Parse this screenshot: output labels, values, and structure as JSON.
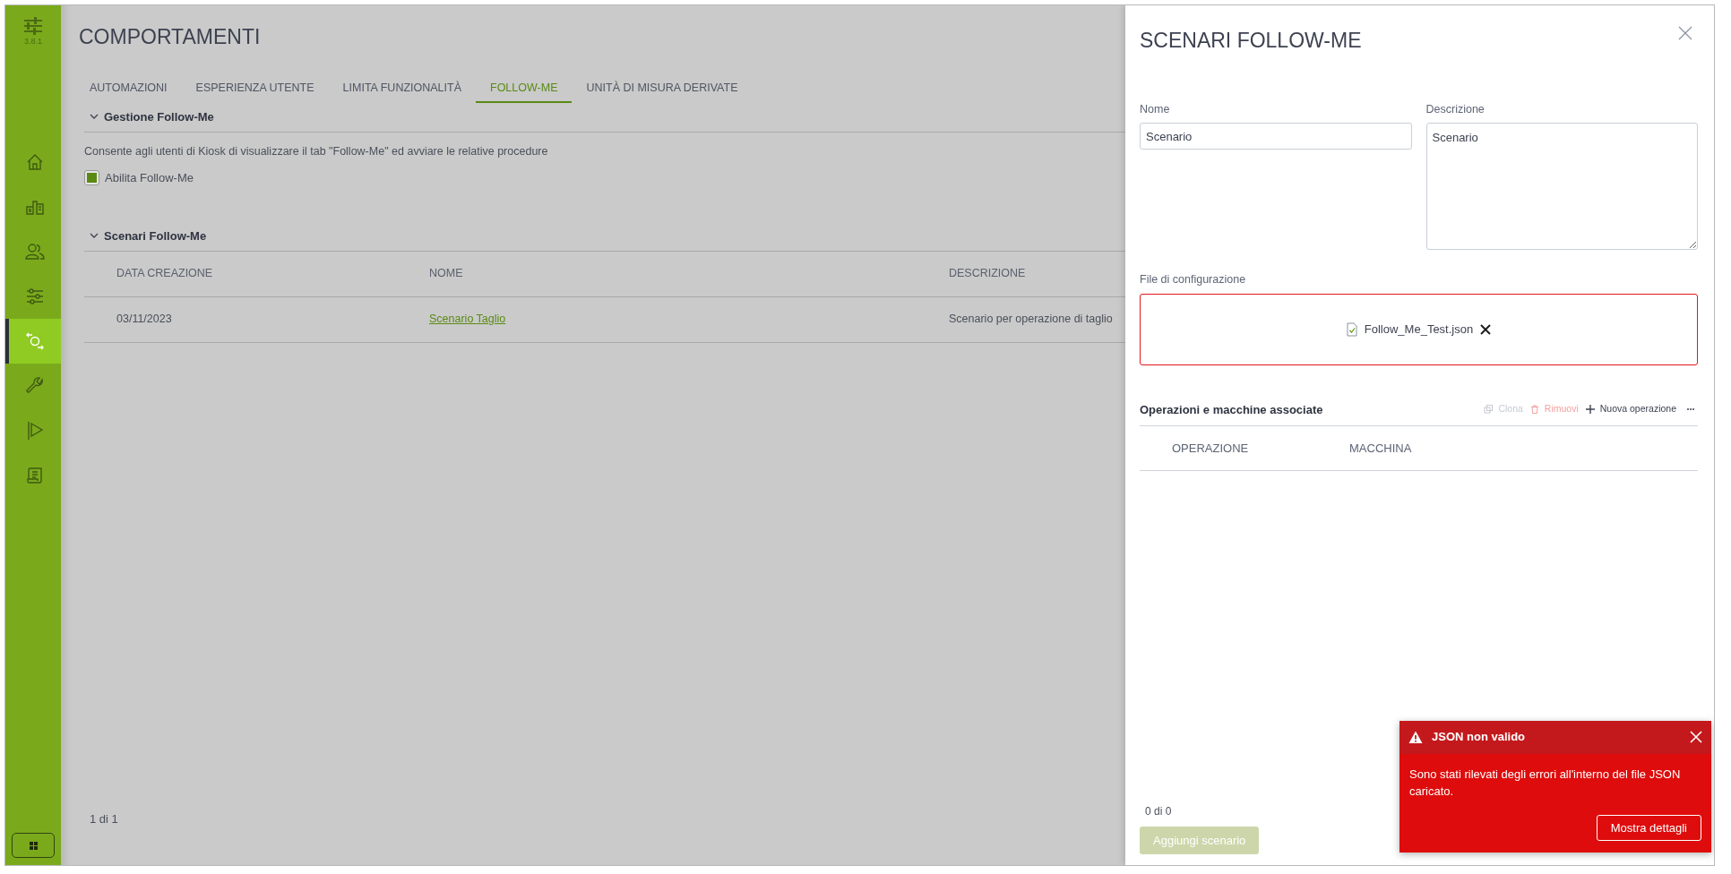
{
  "app": {
    "version": "3.8.1"
  },
  "sidebar": {
    "items": [
      {
        "selected": false
      },
      {
        "selected": false
      },
      {
        "selected": false
      },
      {
        "selected": false
      },
      {
        "selected": true
      },
      {
        "selected": false
      },
      {
        "selected": false
      },
      {
        "selected": false
      }
    ]
  },
  "page": {
    "title": "COMPORTAMENTI"
  },
  "tabs": [
    {
      "label": "AUTOMAZIONI",
      "selected": false
    },
    {
      "label": "ESPERIENZA UTENTE",
      "selected": false
    },
    {
      "label": "LIMITA FUNZIONALITÀ",
      "selected": false
    },
    {
      "label": "FOLLOW-ME",
      "selected": true
    },
    {
      "label": "UNITÀ DI MISURA DERIVATE",
      "selected": false
    }
  ],
  "follow_me_management": {
    "title": "Gestione Follow-Me",
    "expanded": true,
    "description": "Consente agli utenti di Kiosk di visualizzare il tab \"Follow-Me\" ed avviare le relative procedure",
    "checkbox": {
      "label": "Abilita Follow-Me",
      "checked": true
    }
  },
  "scenarios_section": {
    "title": "Scenari Follow-Me",
    "expanded": true,
    "table": {
      "columns": [
        "DATA CREAZIONE",
        "NOME",
        "DESCRIZIONE"
      ],
      "rows": [
        {
          "created": "03/11/2023",
          "name": "Scenario Taglio",
          "description": "Scenario per operazione di taglio"
        }
      ]
    },
    "pager": "1 di 1"
  },
  "drawer": {
    "title": "SCENARI FOLLOW-ME",
    "name_field": {
      "label": "Nome",
      "value": "Scenario"
    },
    "description_field": {
      "label": "Descrizione",
      "value": "Scenario"
    },
    "config_file": {
      "label": "File di configurazione",
      "file_name": "Follow_Me_Test.json",
      "invalid": true
    },
    "operations": {
      "title": "Operazioni e macchine associate",
      "actions": [
        {
          "label": "Clona",
          "kind": "clone",
          "disabled": true
        },
        {
          "label": "Rimuovi",
          "kind": "remove",
          "disabled": true
        },
        {
          "label": "Nuova operazione",
          "kind": "add",
          "disabled": false
        }
      ],
      "columns": [
        "OPERAZIONE",
        "MACCHINA"
      ],
      "pager": "0 di 0"
    },
    "submit": {
      "label": "Aggiungi scenario",
      "disabled": true
    }
  },
  "toast": {
    "title": "JSON non valido",
    "message": "Sono stati rilevati degli errori all'interno del file JSON caricato.",
    "button": "Mostra dettagli"
  }
}
